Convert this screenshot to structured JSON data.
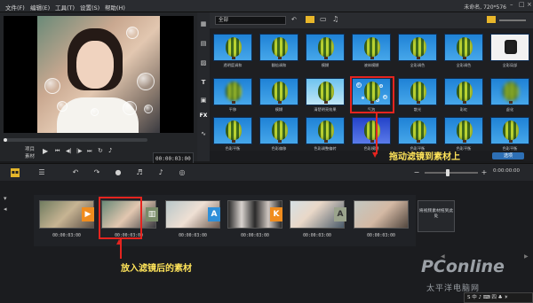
{
  "menubar": {
    "items": [
      "文件(F)",
      "编辑(E)",
      "工具(T)",
      "设置(S)",
      "帮助(H)"
    ],
    "project_info": "未命名, 720*576"
  },
  "preview": {
    "project_label": "项目",
    "clip_label": "素材",
    "timecode": "00:00:03:00",
    "icons": [
      "play-icon",
      "skip-back-icon",
      "step-back-icon",
      "step-forward-icon",
      "skip-forward-icon",
      "repeat-icon",
      "volume-icon"
    ]
  },
  "library": {
    "dropdown_value": "全部",
    "filters": [
      [
        "透明度调和",
        "翻倍调和",
        "模糊",
        "液体模糊",
        "全彩调色",
        "全彩调色",
        "全彩局部"
      ],
      [
        "平移",
        "模糊",
        "清楚明亮效果",
        "气泡",
        "散光",
        "彩虹",
        "虚化"
      ],
      [
        "色彩平衡",
        "色彩偏移",
        "色彩调整偏转",
        "色彩模糊",
        "色彩平衡",
        "色彩平衡",
        "色彩平衡"
      ]
    ],
    "options_label": "选项"
  },
  "timeline": {
    "clip_timecodes": [
      "00:00:03:00",
      "00:00:03:00",
      "00:00:03:00",
      "00:00:03:00",
      "00:00:03:00",
      "00:00:03:00"
    ],
    "placeholder_text": "将视频素材拖到此处",
    "time_display": "0:00:00:00"
  },
  "annotations": {
    "drag_filter": "拖动滤镜到素材上",
    "after_filter": "放入滤镜后的素材"
  },
  "watermark": {
    "brand": "PConline",
    "sub": "太平洋电脑网"
  },
  "taskbar": {
    "text": "S 中 ♪ ⌨ 四 ♣ ☀"
  },
  "colors": {
    "annotation": "#ffe45a",
    "highlight": "#e5241f",
    "accent": "#2d6fb5"
  }
}
